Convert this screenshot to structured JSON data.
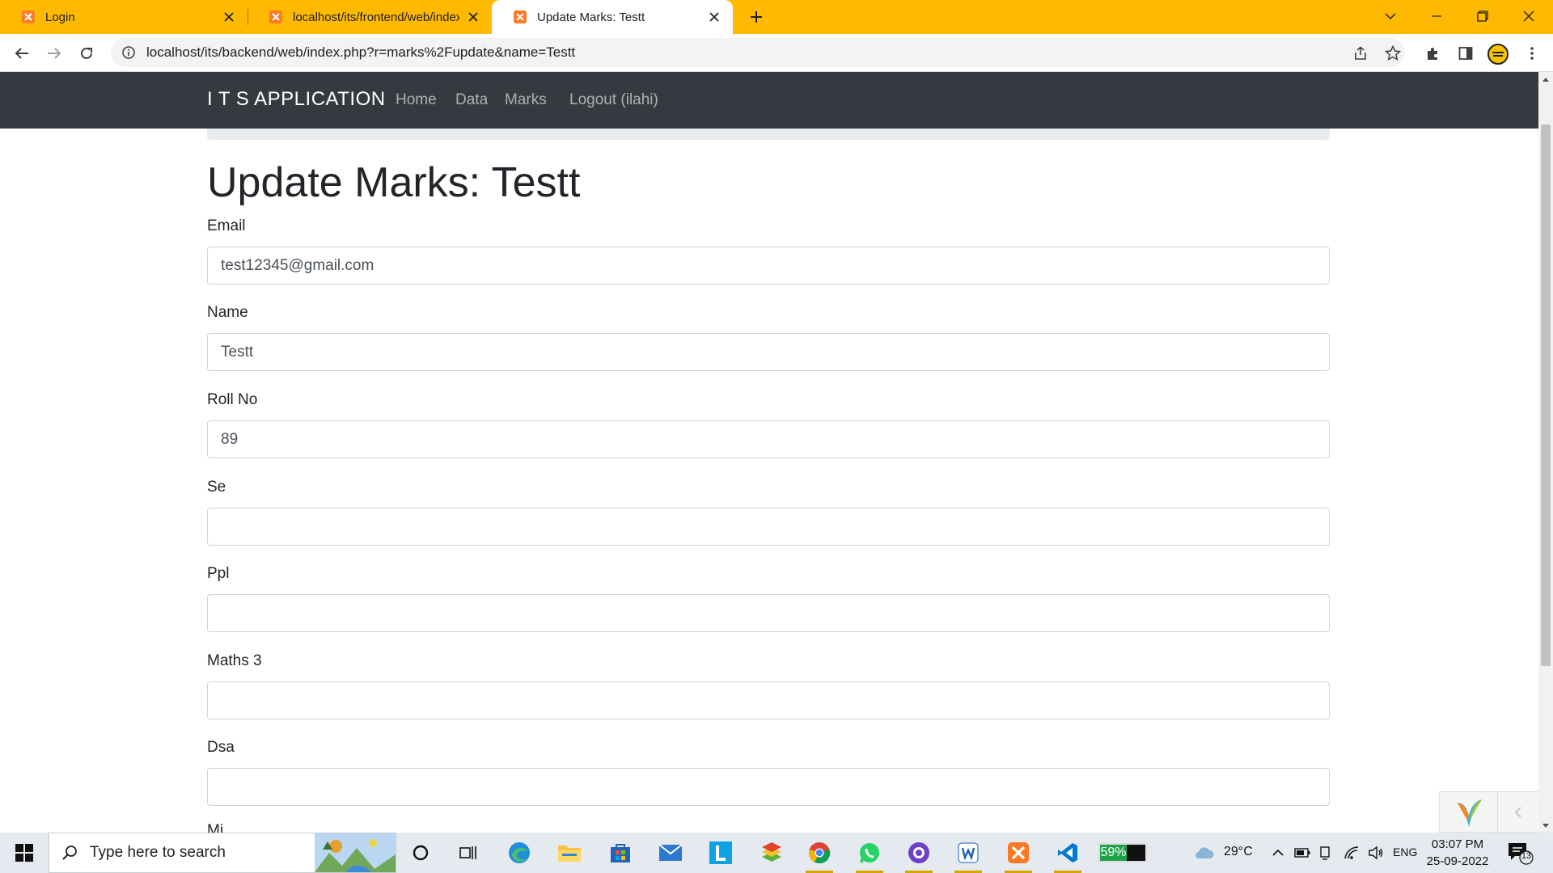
{
  "browser": {
    "tabs": [
      {
        "title": "Login",
        "active": false
      },
      {
        "title": "localhost/its/frontend/web/index",
        "active": false
      },
      {
        "title": "Update Marks: Testt",
        "active": true
      }
    ],
    "address": {
      "url": "localhost/its/backend/web/index.php?r=marks%2Fupdate&name=Testt"
    },
    "theme_color": "#ffb900"
  },
  "app": {
    "brand": "I T S APPLICATION",
    "nav": {
      "home": "Home",
      "data": "Data",
      "marks": "Marks",
      "logout": "Logout (ilahi)"
    },
    "navbar_color": "#343a40"
  },
  "page": {
    "heading": "Update Marks: Testt",
    "fields": {
      "email": {
        "label": "Email",
        "value": "test12345@gmail.com"
      },
      "name": {
        "label": "Name",
        "value": "Testt"
      },
      "roll_no": {
        "label": "Roll No",
        "value": "89"
      },
      "se": {
        "label": "Se",
        "value": ""
      },
      "ppl": {
        "label": "Ppl",
        "value": ""
      },
      "maths3": {
        "label": "Maths 3",
        "value": ""
      },
      "dsa": {
        "label": "Dsa",
        "value": ""
      },
      "next_cut": {
        "label": "Mi"
      }
    }
  },
  "taskbar": {
    "search_placeholder": "Type here to search",
    "battery_percent": "59%",
    "weather": "29°C",
    "language": "ENG",
    "time": "03:07 PM",
    "date": "25-09-2022",
    "notification_count": "13",
    "apps": [
      "task-view-icon",
      "edge-icon",
      "file-explorer-icon",
      "store-icon",
      "mail-icon",
      "l-app-icon",
      "bluestacks-icon",
      "chrome-icon",
      "whatsapp-icon",
      "github-desktop-icon",
      "word-icon",
      "xampp-icon",
      "vscode-icon"
    ]
  }
}
